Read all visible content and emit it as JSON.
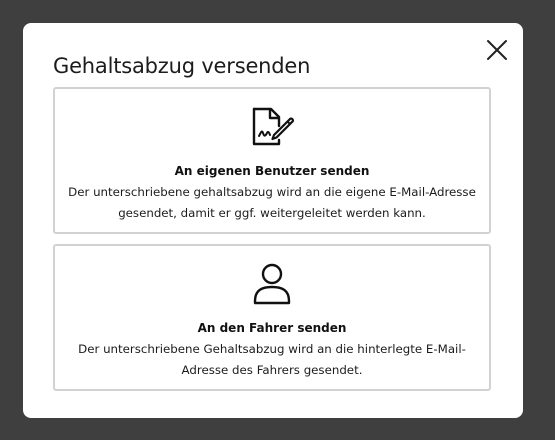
{
  "dialog": {
    "title": "Gehaltsabzug versenden",
    "close_icon": "close-icon"
  },
  "options": [
    {
      "icon": "signed-document-icon",
      "title": "An eigenen Benutzer senden",
      "description": "Der unterschriebene gehaltsabzug wird an die eigene E-Mail-Adresse gesendet, damit er ggf. weitergeleitet werden kann."
    },
    {
      "icon": "user-icon",
      "title": "An den Fahrer senden",
      "description": "Der unterschriebene Gehaltsabzug wird an die hinterlegte E-Mail-Adresse des Fahrers gesendet."
    }
  ],
  "colors": {
    "backdrop": "#3f3f3f",
    "dialog_background": "#ffffff",
    "card_border": "#d2d2d2",
    "text": "#1c1c1c"
  }
}
